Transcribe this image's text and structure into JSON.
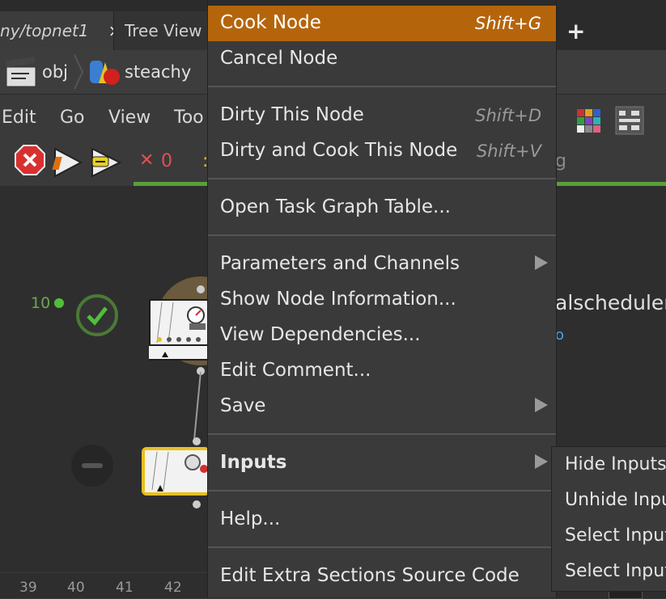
{
  "tabs": {
    "network_tab": "ny/topnet1",
    "network_tab_close": "×",
    "tree_tab": "Tree View",
    "add_tab": "+"
  },
  "path": {
    "obj": "obj",
    "steachy": "steachy"
  },
  "menubar": {
    "edit": "Edit",
    "go": "Go",
    "view": "View",
    "tools": "Too"
  },
  "toolbar": {
    "fail_count": "0",
    "x_mark": "✕",
    "right_tag": "g"
  },
  "network": {
    "node_count_label": "10",
    "scheduler_text": "alscheduler",
    "scheduler_sub": "o"
  },
  "ruler": [
    "39",
    "40",
    "41",
    "42"
  ],
  "context_menu": {
    "cook_node": {
      "label": "Cook Node",
      "shortcut": "Shift+G"
    },
    "cancel_node": {
      "label": "Cancel Node"
    },
    "dirty_node": {
      "label": "Dirty This Node",
      "shortcut": "Shift+D"
    },
    "dirty_cook": {
      "label": "Dirty and Cook This Node",
      "shortcut": "Shift+V"
    },
    "open_task_graph": {
      "label": "Open Task Graph Table..."
    },
    "params_channels": {
      "label": "Parameters and Channels"
    },
    "show_info": {
      "label": "Show Node Information..."
    },
    "view_deps": {
      "label": "View Dependencies..."
    },
    "edit_comment": {
      "label": "Edit Comment..."
    },
    "save": {
      "label": "Save"
    },
    "inputs": {
      "label": "Inputs"
    },
    "help": {
      "label": "Help..."
    },
    "edit_extra": {
      "label": "Edit Extra Sections Source Code"
    }
  },
  "inputs_submenu": {
    "hide": "Hide Inputs",
    "unhide": "Unhide Inpu",
    "select1": "Select Input",
    "select2": "Select Input"
  },
  "colors": {
    "highlight": "#b4650c",
    "accent_green": "#5a9e3a",
    "link_blue": "#4aa0e8"
  }
}
